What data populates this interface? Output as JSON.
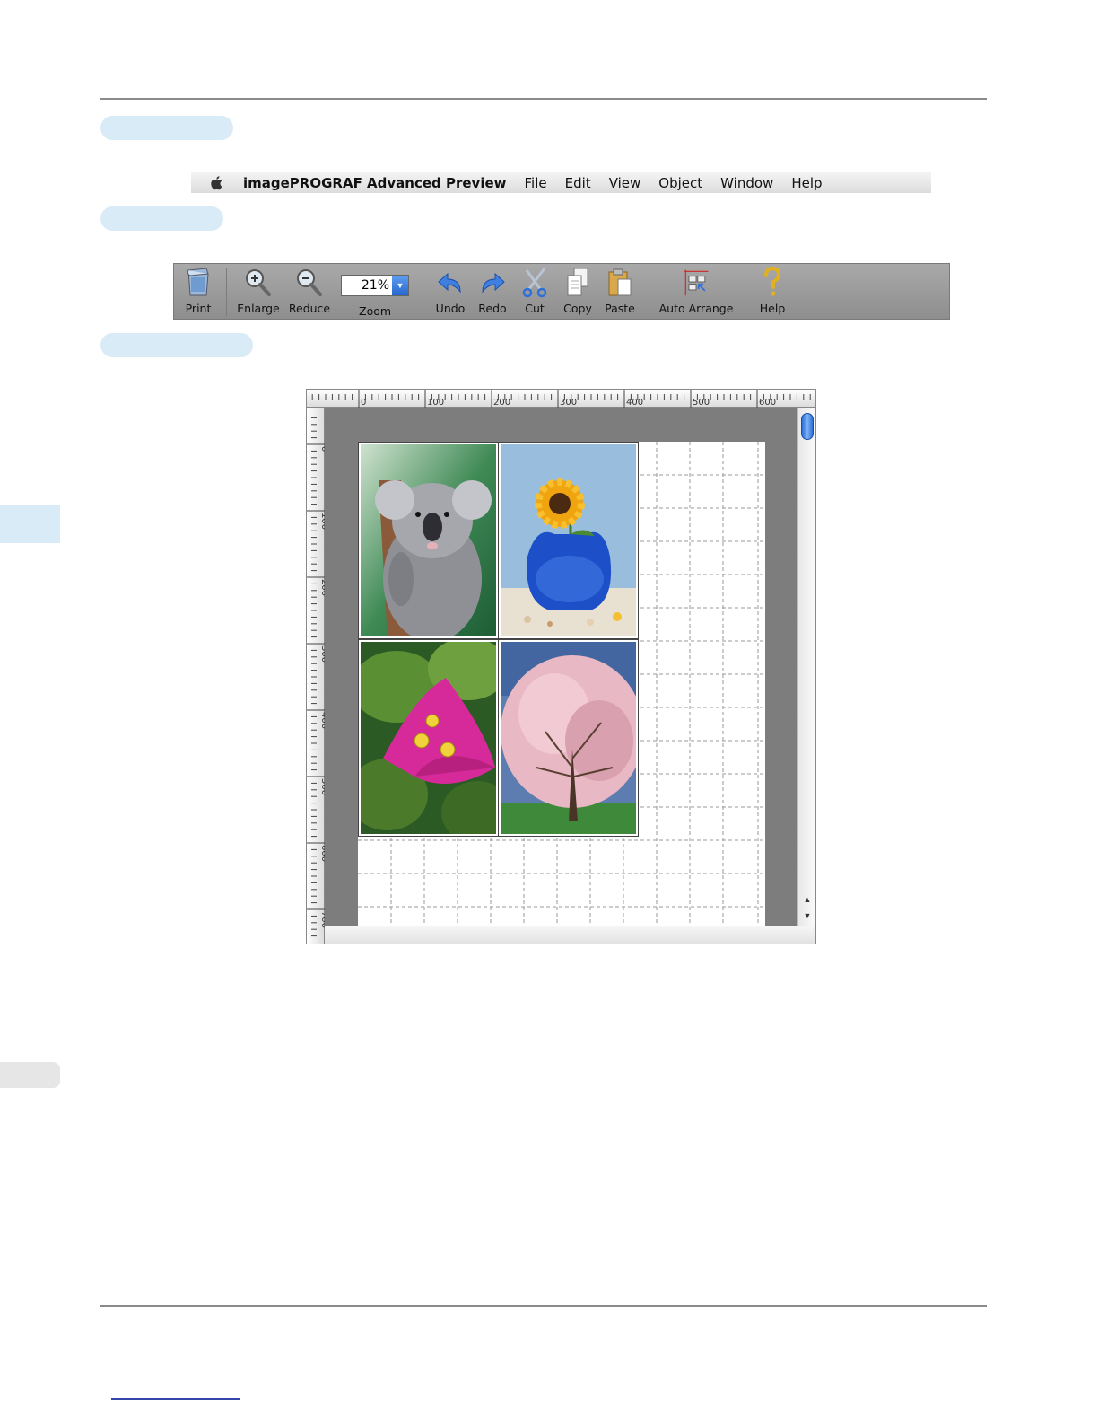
{
  "menubar": {
    "app_name": "imagePROGRAF Advanced Preview",
    "items": [
      "File",
      "Edit",
      "View",
      "Object",
      "Window",
      "Help"
    ]
  },
  "toolbar": {
    "print": "Print",
    "enlarge": "Enlarge",
    "reduce": "Reduce",
    "zoom_label": "Zoom",
    "zoom_value": "21%",
    "undo": "Undo",
    "redo": "Redo",
    "cut": "Cut",
    "copy": "Copy",
    "paste": "Paste",
    "auto_arrange": "Auto Arrange",
    "help": "Help"
  },
  "preview": {
    "ruler_h_labels": [
      "0",
      "100",
      "200",
      "300",
      "400",
      "500",
      "600"
    ],
    "ruler_v_labels": [
      "0",
      "100",
      "200",
      "300",
      "400",
      "500",
      "600",
      "700"
    ],
    "photos": [
      "koala",
      "sunflower-vase",
      "pink-bougainvillea",
      "cherry-blossom-tree"
    ]
  },
  "colors": {
    "heading_pill": "#d8ebf7",
    "canvas_bg": "#7d7d7d",
    "accent_blue": "#2a6ed8"
  }
}
